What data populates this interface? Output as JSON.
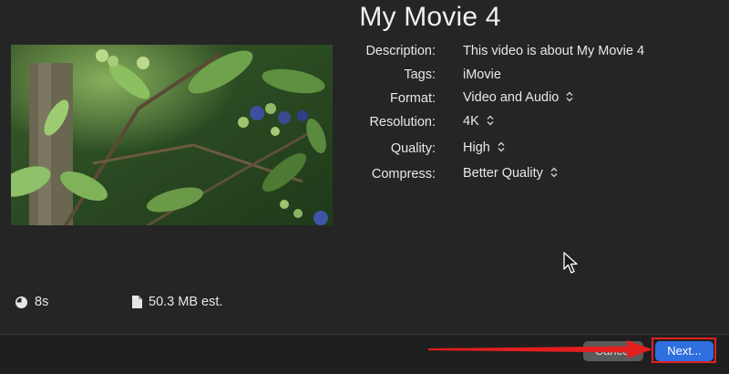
{
  "title": "My Movie 4",
  "fields": {
    "description": {
      "label": "Description:",
      "value": "This video is about My Movie 4"
    },
    "tags": {
      "label": "Tags:",
      "value": "iMovie"
    },
    "format": {
      "label": "Format:",
      "value": "Video and Audio"
    },
    "resolution": {
      "label": "Resolution:",
      "value": "4K"
    },
    "quality": {
      "label": "Quality:",
      "value": "High"
    },
    "compress": {
      "label": "Compress:",
      "value": "Better Quality"
    }
  },
  "footer": {
    "duration": "8s",
    "file_size": "50.3 MB est."
  },
  "buttons": {
    "cancel": "Cancel",
    "next": "Next..."
  },
  "colors": {
    "background": "#252525",
    "accent": "#2f6fe0",
    "annotation": "#e41e1e"
  },
  "icons": {
    "duration": "clock-icon",
    "file_size": "document-icon",
    "popup": "chevron-updown-icon"
  }
}
